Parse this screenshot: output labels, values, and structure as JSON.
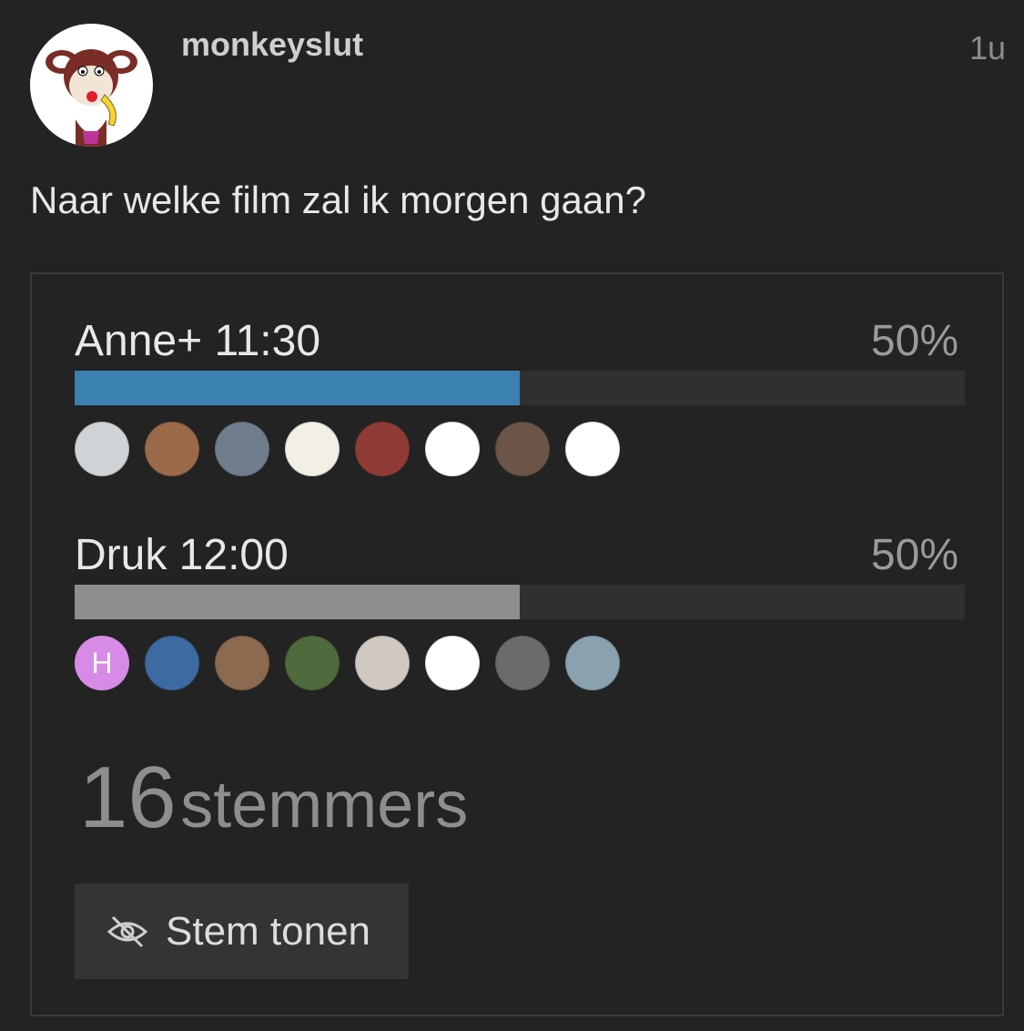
{
  "post": {
    "username": "monkeyslut",
    "timestamp": "1u",
    "question": "Naar welke film zal ik morgen gaan?",
    "avatar_icon": "monkey-banana-icon"
  },
  "poll": {
    "options": [
      {
        "label": "Anne+ 11:30",
        "percent_label": "50%",
        "fraction": 0.5,
        "bar_color": "#3a80b1",
        "voters": [
          {
            "name": "voter-avatar-polar-bear",
            "bg": "#cfd3d6"
          },
          {
            "name": "voter-avatar-woman-blonde",
            "bg": "#9b6a4a"
          },
          {
            "name": "voter-avatar-man-suit",
            "bg": "#6f7d8d"
          },
          {
            "name": "voter-avatar-california-flag",
            "bg": "#f2efe6"
          },
          {
            "name": "voter-avatar-rooster",
            "bg": "#8f3c36"
          },
          {
            "name": "voter-avatar-cookie",
            "bg": "#ffffff"
          },
          {
            "name": "voter-avatar-two-women",
            "bg": "#6b5448"
          },
          {
            "name": "voter-avatar-pretzel-logo",
            "bg": "#ffffff"
          }
        ]
      },
      {
        "label": "Druk 12:00",
        "percent_label": "50%",
        "fraction": 0.5,
        "bar_color": "#8e8e8e",
        "voters": [
          {
            "name": "voter-avatar-initial-h",
            "bg": "#d78be6",
            "initial": "H"
          },
          {
            "name": "voter-avatar-sun-sky",
            "bg": "#3d6aa3"
          },
          {
            "name": "voter-avatar-woman-phone",
            "bg": "#8b6a50"
          },
          {
            "name": "voter-avatar-zebras",
            "bg": "#4f6a3c"
          },
          {
            "name": "voter-avatar-white-dog",
            "bg": "#cfc9c2"
          },
          {
            "name": "voter-avatar-penguin-meme",
            "bg": "#ffffff"
          },
          {
            "name": "voter-avatar-woman-bw",
            "bg": "#6b6b6b"
          },
          {
            "name": "voter-avatar-tattoo-man",
            "bg": "#8aa2b0"
          }
        ]
      }
    ],
    "voter_count": "16",
    "voter_word": "stemmers",
    "show_vote_button": "Stem tonen",
    "show_vote_icon": "eye-slash-icon"
  }
}
